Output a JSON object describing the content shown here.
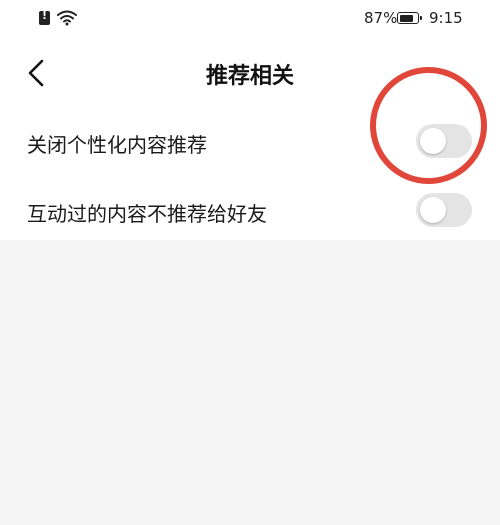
{
  "status_bar": {
    "battery_percent": "87%",
    "battery_level": 0.87,
    "time": "9:15",
    "icons": [
      "sim-alert-icon",
      "wifi-icon",
      "battery-icon"
    ]
  },
  "header": {
    "title": "推荐相关",
    "back_icon": "chevron-left-icon"
  },
  "settings": [
    {
      "label": "关闭个性化内容推荐",
      "enabled": false
    },
    {
      "label": "互动过的内容不推荐给好友",
      "enabled": false
    }
  ],
  "colors": {
    "annotation_circle": "#e0463a",
    "toggle_off": "#e4e4e4",
    "page_background": "#f5f5f5"
  }
}
